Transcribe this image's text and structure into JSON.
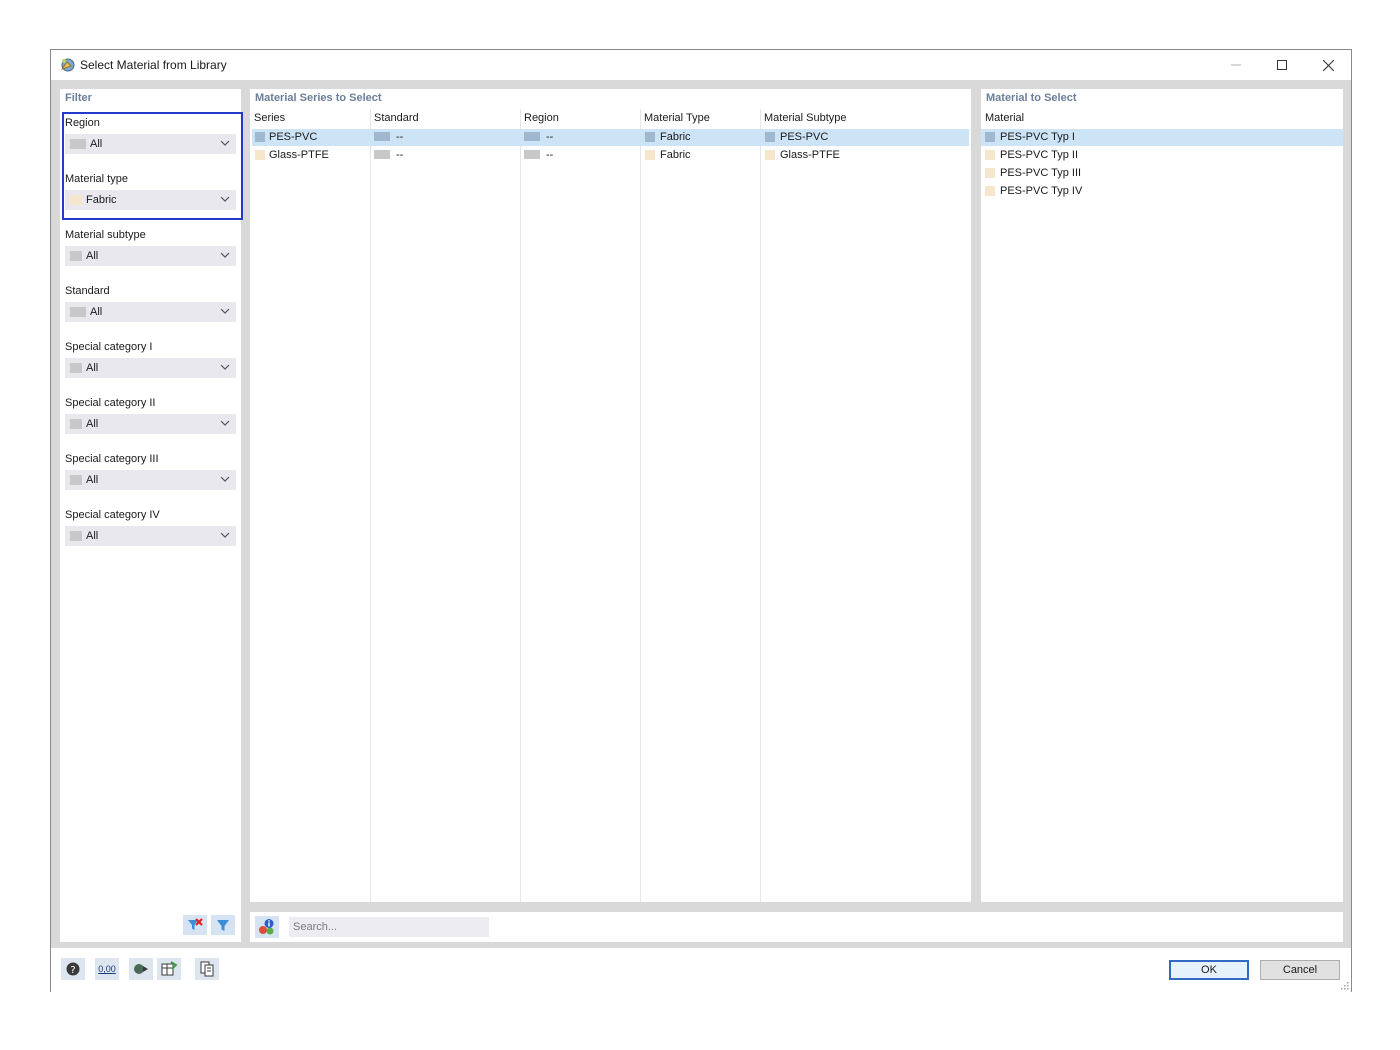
{
  "window": {
    "title": "Select Material from Library"
  },
  "filter": {
    "heading": "Filter",
    "groups": [
      {
        "label": "Region",
        "value": "All",
        "swatch": "#c8c8c8"
      },
      {
        "label": "Material type",
        "value": "Fabric",
        "swatch": "#f5e6cc"
      },
      {
        "label": "Material subtype",
        "value": "All",
        "swatch": "#c8c8c8"
      },
      {
        "label": "Standard",
        "value": "All",
        "swatch": "#c8c8c8"
      },
      {
        "label": "Special category I",
        "value": "All",
        "swatch": "#c8c8c8"
      },
      {
        "label": "Special category II",
        "value": "All",
        "swatch": "#c8c8c8"
      },
      {
        "label": "Special category III",
        "value": "All",
        "swatch": "#c8c8c8"
      },
      {
        "label": "Special category IV",
        "value": "All",
        "swatch": "#c8c8c8"
      }
    ]
  },
  "series": {
    "heading": "Material Series to Select",
    "columns": [
      "Series",
      "Standard",
      "Region",
      "Material Type",
      "Material Subtype"
    ],
    "rows": [
      {
        "selected": true,
        "series": "PES-PVC",
        "standard": "--",
        "region": "--",
        "type": "Fabric",
        "subtype": "PES-PVC"
      },
      {
        "selected": false,
        "series": "Glass-PTFE",
        "standard": "--",
        "region": "--",
        "type": "Fabric",
        "subtype": "Glass-PTFE"
      }
    ]
  },
  "material": {
    "heading": "Material to Select",
    "column": "Material",
    "rows": [
      "PES-PVC Typ I",
      "PES-PVC Typ II",
      "PES-PVC Typ III",
      "PES-PVC Typ IV"
    ]
  },
  "search": {
    "placeholder": "Search..."
  },
  "buttons": {
    "ok": "OK",
    "cancel": "Cancel"
  },
  "tools": {
    "units_label": "0,00"
  },
  "colors": {
    "selection": "#cde4f7",
    "highlight_border": "#1f3ccf",
    "header_text": "#6b7f9a",
    "fabric_swatch": "#f5e6cc",
    "selected_swatch": "#9fb8d0"
  }
}
